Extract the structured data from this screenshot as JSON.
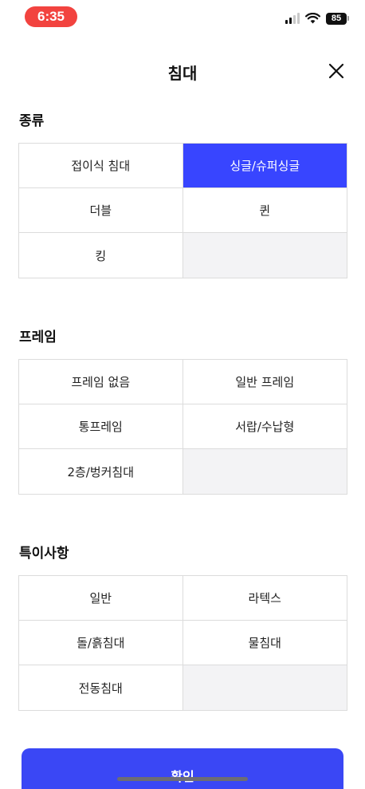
{
  "status_bar": {
    "time": "6:35",
    "battery": "85"
  },
  "header": {
    "title": "침대"
  },
  "sections": [
    {
      "title": "종류",
      "options": [
        {
          "label": "접이식 침대",
          "selected": false
        },
        {
          "label": "싱글/슈퍼싱글",
          "selected": true
        },
        {
          "label": "더블",
          "selected": false
        },
        {
          "label": "퀸",
          "selected": false
        },
        {
          "label": "킹",
          "selected": false
        }
      ]
    },
    {
      "title": "프레임",
      "options": [
        {
          "label": "프레임 없음",
          "selected": false
        },
        {
          "label": "일반 프레임",
          "selected": false
        },
        {
          "label": "통프레임",
          "selected": false
        },
        {
          "label": "서랍/수납형",
          "selected": false
        },
        {
          "label": "2층/벙커침대",
          "selected": false
        }
      ]
    },
    {
      "title": "특이사항",
      "options": [
        {
          "label": "일반",
          "selected": false
        },
        {
          "label": "라텍스",
          "selected": false
        },
        {
          "label": "돌/흙침대",
          "selected": false
        },
        {
          "label": "물침대",
          "selected": false
        },
        {
          "label": "전동침대",
          "selected": false
        }
      ]
    }
  ],
  "confirm": {
    "label": "확인"
  },
  "colors": {
    "accent": "#3845ff",
    "status_pill": "#f2433f",
    "empty_cell": "#f3f3f5",
    "border": "#dcdcdc"
  }
}
